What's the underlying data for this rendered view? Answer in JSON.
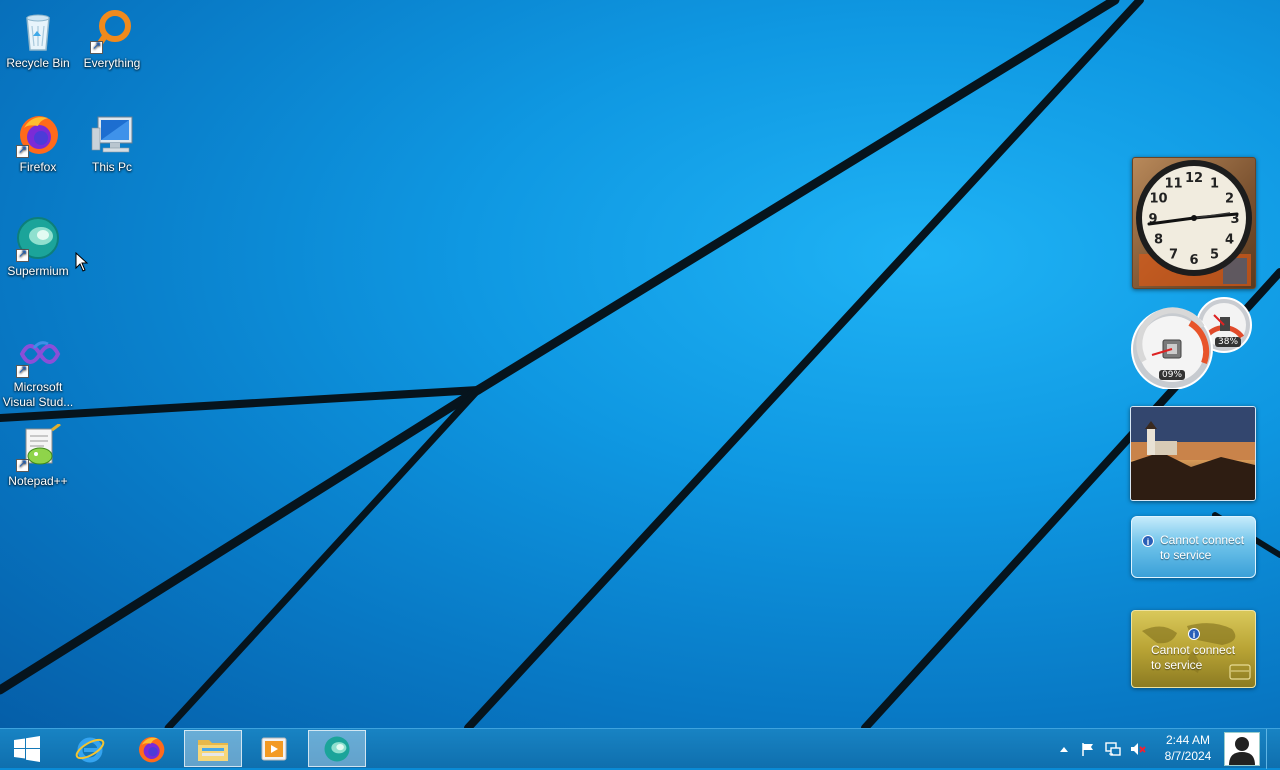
{
  "desktop": {
    "icons": [
      {
        "label": "Recycle Bin",
        "icon": "recycle-bin-icon"
      },
      {
        "label": "Everything",
        "icon": "everything-search-icon"
      },
      {
        "label": "Firefox",
        "icon": "firefox-icon"
      },
      {
        "label": "This Pc",
        "icon": "this-pc-icon"
      },
      {
        "label": "Supermium",
        "icon": "supermium-icon"
      },
      {
        "label": "Microsoft Visual Stud...",
        "icon": "visual-studio-icon"
      },
      {
        "label": "Notepad++",
        "icon": "notepad-plus-plus-icon"
      }
    ]
  },
  "gadgets": {
    "clock": {
      "hour_numbers": [
        "12",
        "1",
        "2",
        "3",
        "4",
        "5",
        "6",
        "7",
        "8",
        "9",
        "10",
        "11"
      ]
    },
    "cpu_meter": {
      "cpu_percent": "09%",
      "memory_percent": "38%"
    },
    "weather": {
      "message_line1": "Cannot connect",
      "message_line2": "to service"
    },
    "currency": {
      "message_line1": "Cannot connect",
      "message_line2": "to service"
    }
  },
  "taskbar": {
    "pinned": [
      {
        "name": "internet-explorer",
        "icon": "internet-explorer-icon",
        "active": false
      },
      {
        "name": "firefox",
        "icon": "firefox-icon",
        "active": false
      },
      {
        "name": "file-explorer",
        "icon": "folder-icon",
        "active": true
      },
      {
        "name": "media-player",
        "icon": "media-player-icon",
        "active": false
      },
      {
        "name": "supermium",
        "icon": "supermium-icon",
        "active": true
      }
    ],
    "clock": {
      "time": "2:44 AM",
      "date": "8/7/2024"
    }
  },
  "colors": {
    "taskbar": "#1177b8",
    "desktop_blue": "#0f98e2"
  }
}
